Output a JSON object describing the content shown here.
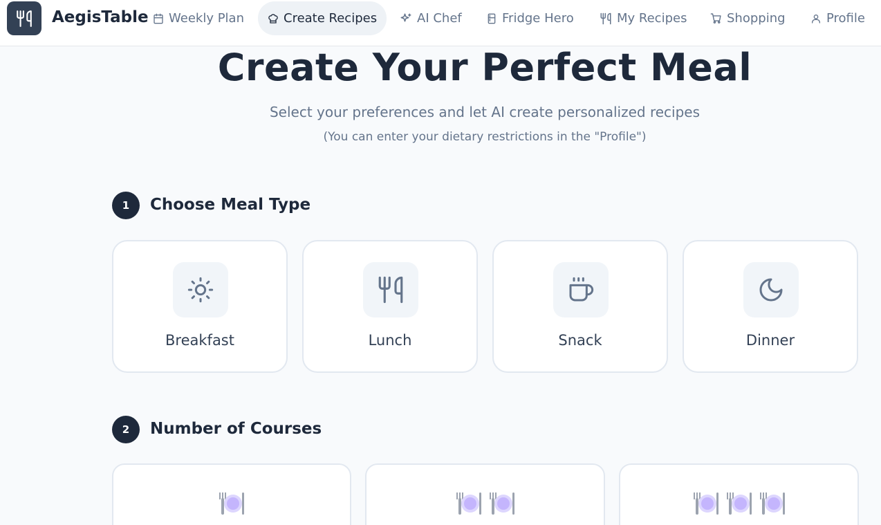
{
  "app": {
    "brand": "AegisTable"
  },
  "nav": {
    "items": [
      {
        "label": "Weekly Plan",
        "icon": "calendar-icon"
      },
      {
        "label": "Create Recipes",
        "icon": "chef-hat-icon",
        "active": true
      },
      {
        "label": "AI Chef",
        "icon": "sparkles-icon"
      },
      {
        "label": "Fridge Hero",
        "icon": "fridge-icon"
      },
      {
        "label": "My Recipes",
        "icon": "utensils-icon"
      },
      {
        "label": "Shopping",
        "icon": "cart-icon"
      },
      {
        "label": "Profile",
        "icon": "user-icon"
      }
    ]
  },
  "hero": {
    "title": "Create Your Perfect Meal",
    "subtitle": "Select your preferences and let AI create personalized recipes",
    "note": "(You can enter your dietary restrictions in the \"Profile\")"
  },
  "section1": {
    "step": "1",
    "title": "Choose Meal Type",
    "options": [
      {
        "label": "Breakfast",
        "icon": "sun-icon"
      },
      {
        "label": "Lunch",
        "icon": "utensils-icon"
      },
      {
        "label": "Snack",
        "icon": "coffee-icon"
      },
      {
        "label": "Dinner",
        "icon": "moon-icon"
      }
    ]
  },
  "section2": {
    "step": "2",
    "title": "Number of Courses",
    "options": [
      {
        "plates": 1,
        "icon": "plate-icon"
      },
      {
        "plates": 2,
        "icon": "plate-icon"
      },
      {
        "plates": 3,
        "icon": "plate-icon"
      }
    ]
  },
  "colors": {
    "primary": "#1e293b",
    "muted_text": "#64748b",
    "card_border": "#e2e8f0",
    "icon_bg": "#f1f5f9",
    "background": "#f8fafc"
  }
}
